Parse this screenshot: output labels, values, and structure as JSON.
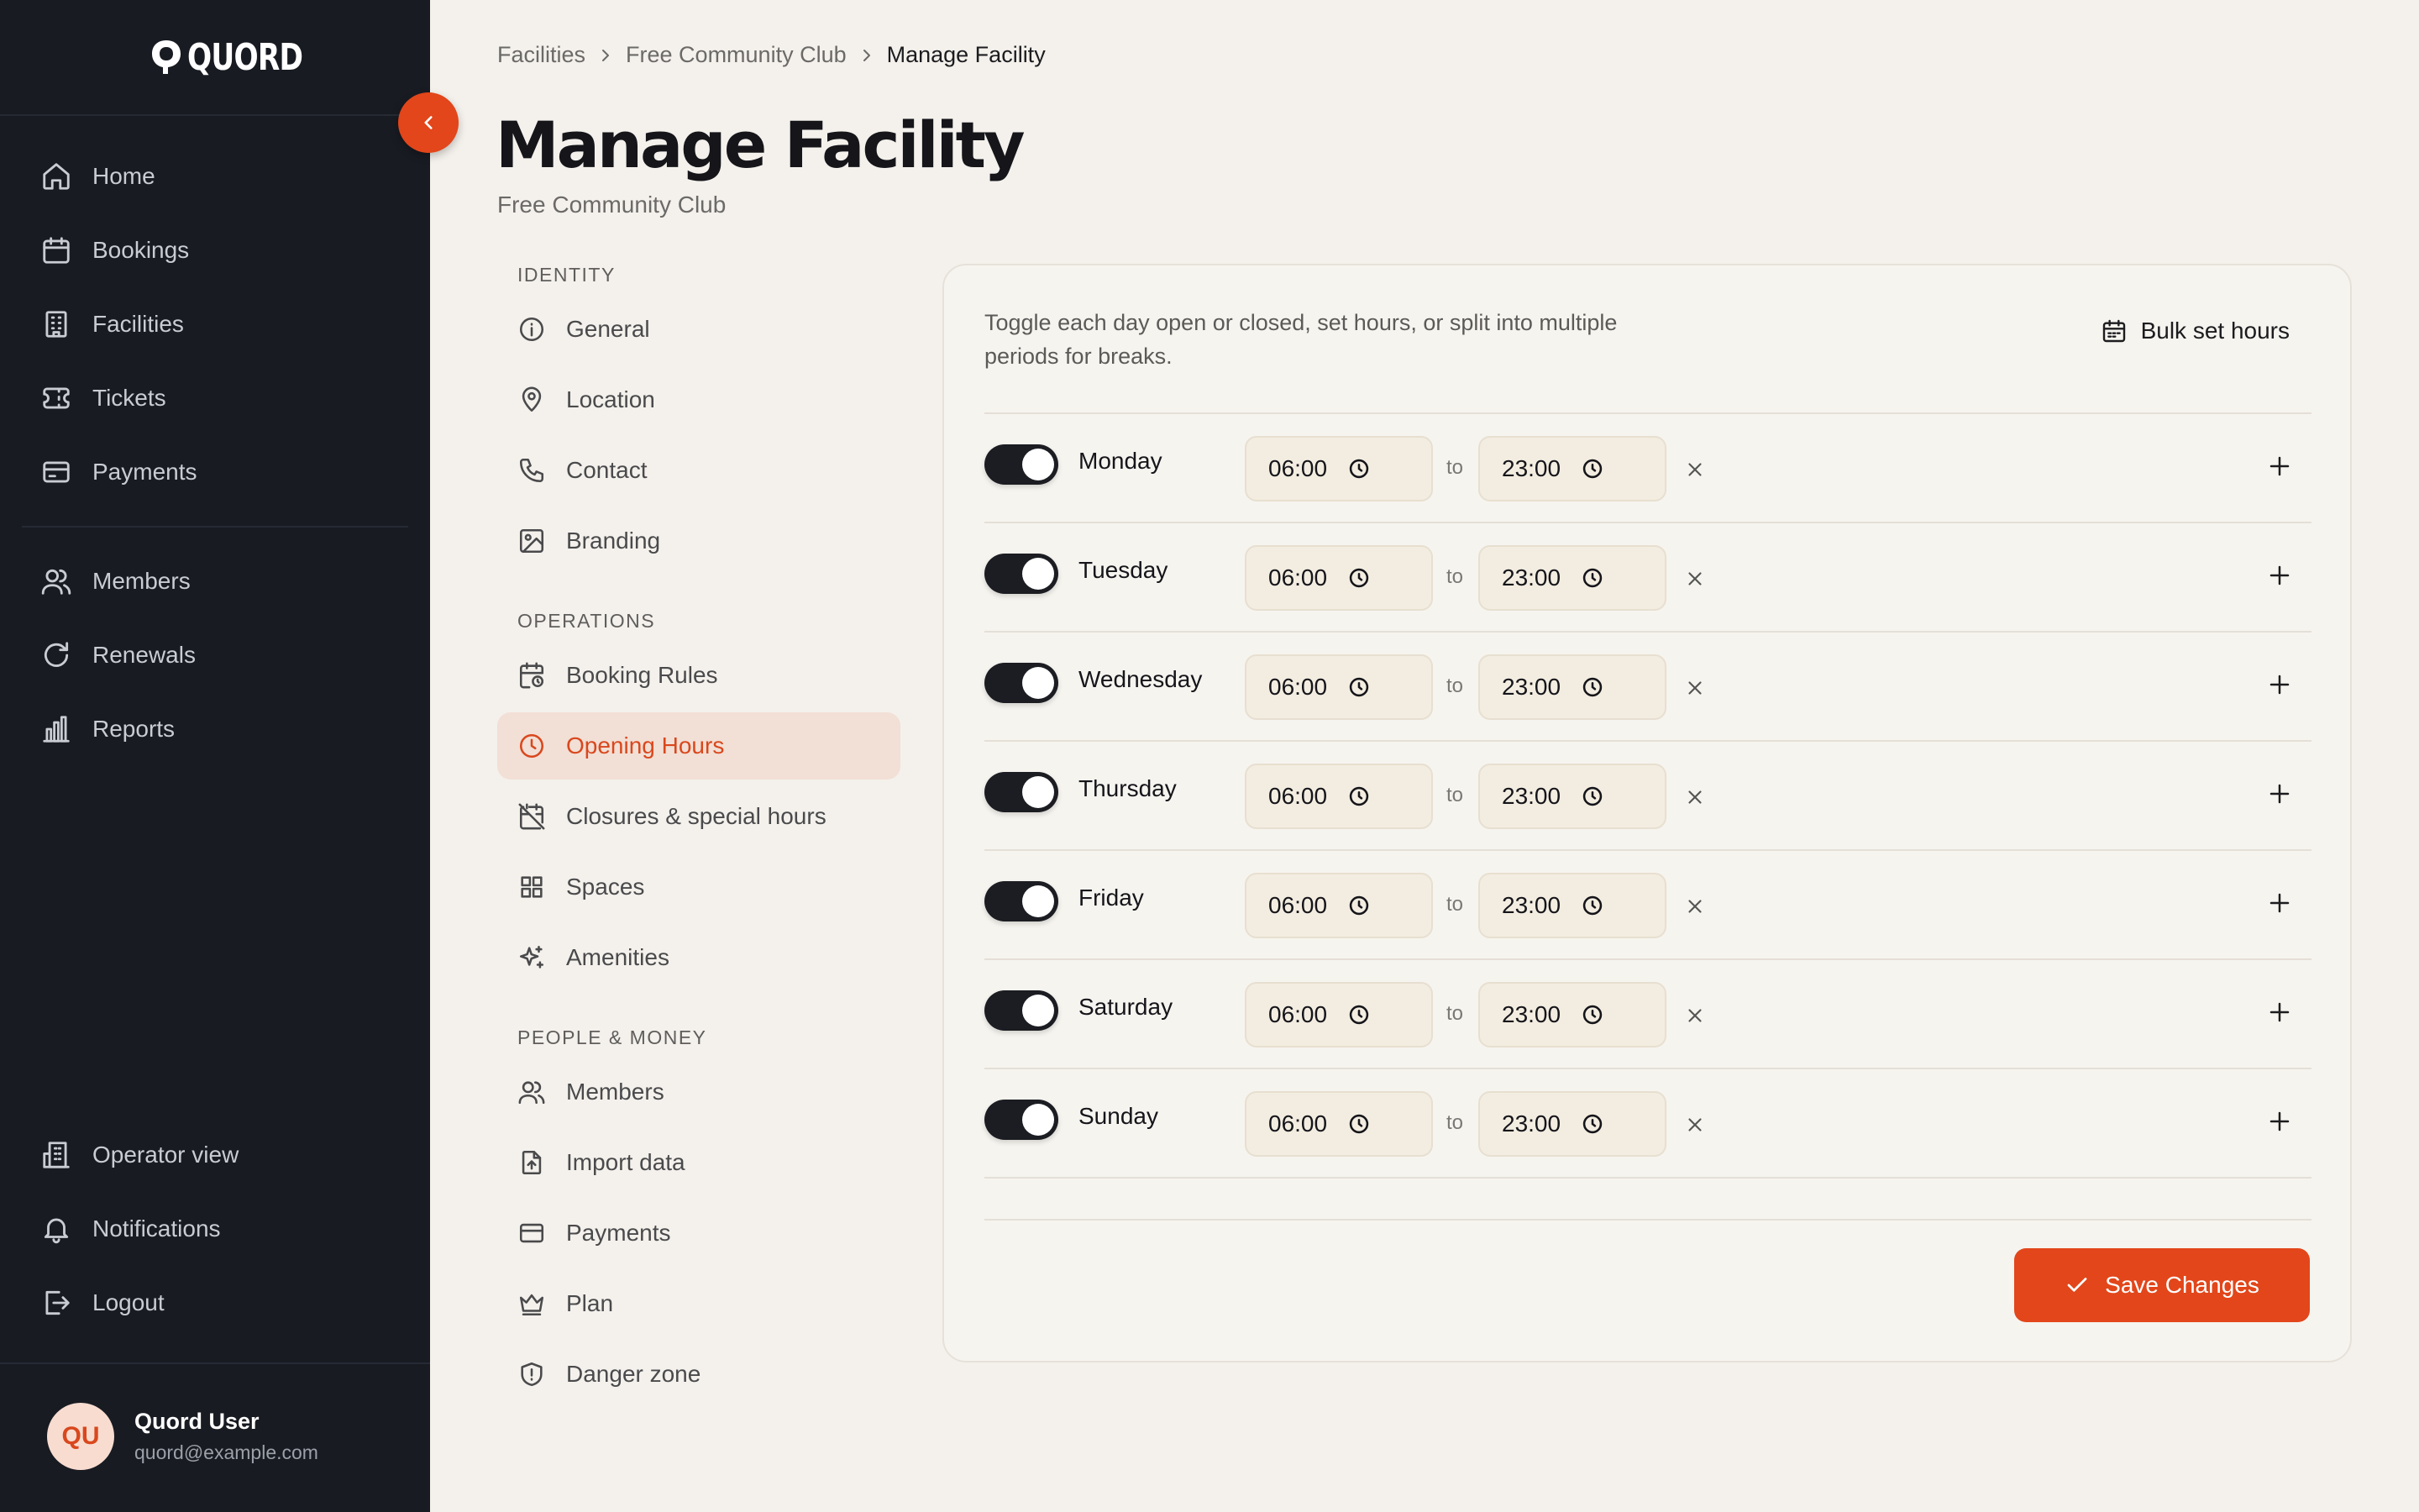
{
  "app": {
    "logo_text": "QUORD",
    "colors": {
      "accent": "#e2461a",
      "sidebar_bg": "#181b22",
      "page_bg": "#f4f1ec"
    }
  },
  "sidebar": {
    "main_items": [
      {
        "label": "Home",
        "icon": "home-icon"
      },
      {
        "label": "Bookings",
        "icon": "calendar-icon"
      },
      {
        "label": "Facilities",
        "icon": "building-icon"
      },
      {
        "label": "Tickets",
        "icon": "ticket-icon"
      },
      {
        "label": "Payments",
        "icon": "credit-card-icon"
      }
    ],
    "secondary_items": [
      {
        "label": "Members",
        "icon": "users-icon"
      },
      {
        "label": "Renewals",
        "icon": "refresh-icon"
      },
      {
        "label": "Reports",
        "icon": "bar-chart-icon"
      }
    ],
    "bottom_items": [
      {
        "label": "Operator view",
        "icon": "building-2-icon"
      },
      {
        "label": "Notifications",
        "icon": "bell-icon"
      },
      {
        "label": "Logout",
        "icon": "logout-icon"
      }
    ],
    "user": {
      "initials": "QU",
      "name": "Quord User",
      "email": "quord@example.com"
    }
  },
  "breadcrumb": [
    "Facilities",
    "Free Community Club",
    "Manage Facility"
  ],
  "page": {
    "title": "Manage Facility",
    "subtitle": "Free Community Club"
  },
  "settings_menu": {
    "sections": [
      {
        "heading": "IDENTITY",
        "items": [
          "General",
          "Location",
          "Contact",
          "Branding"
        ]
      },
      {
        "heading": "OPERATIONS",
        "items": [
          "Booking Rules",
          "Opening Hours",
          "Closures & special hours",
          "Spaces",
          "Amenities"
        ]
      },
      {
        "heading": "PEOPLE & MONEY",
        "items": [
          "Members",
          "Import data",
          "Payments",
          "Plan",
          "Danger zone"
        ]
      }
    ],
    "active_item": "Opening Hours"
  },
  "opening_hours": {
    "description": "Toggle each day open or closed, set hours, or split into multiple periods for breaks.",
    "bulk_label": "Bulk set hours",
    "to_label": "to",
    "days": [
      {
        "name": "Monday",
        "open": true,
        "start": "06:00",
        "end": "23:00"
      },
      {
        "name": "Tuesday",
        "open": true,
        "start": "06:00",
        "end": "23:00"
      },
      {
        "name": "Wednesday",
        "open": true,
        "start": "06:00",
        "end": "23:00"
      },
      {
        "name": "Thursday",
        "open": true,
        "start": "06:00",
        "end": "23:00"
      },
      {
        "name": "Friday",
        "open": true,
        "start": "06:00",
        "end": "23:00"
      },
      {
        "name": "Saturday",
        "open": true,
        "start": "06:00",
        "end": "23:00"
      },
      {
        "name": "Sunday",
        "open": true,
        "start": "06:00",
        "end": "23:00"
      }
    ],
    "save_label": "Save Changes"
  }
}
